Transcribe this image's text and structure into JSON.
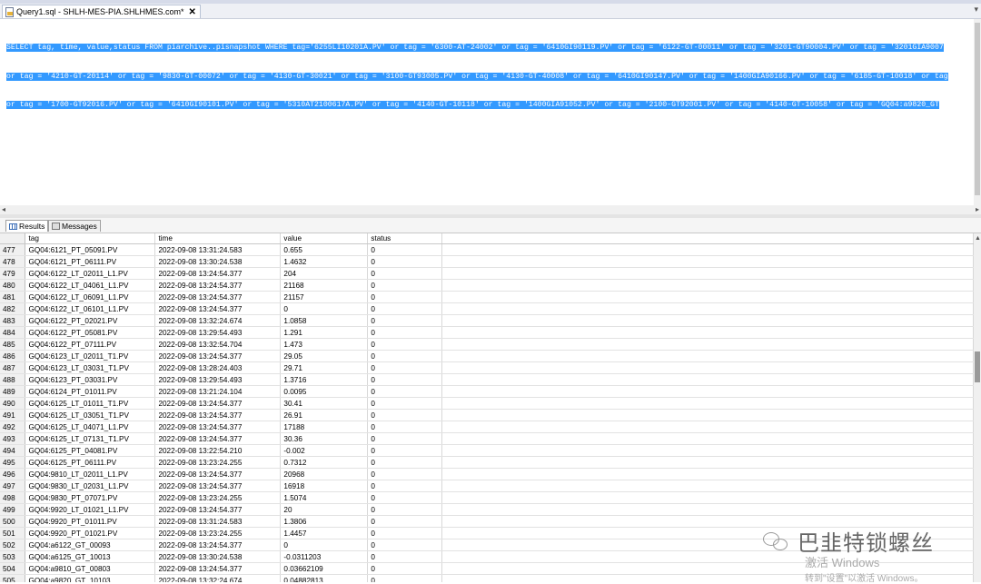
{
  "window": {
    "tab_title": "Query1.sql - SHLH-MES-PIA.SHLHMES.com*",
    "tab_close": "✕",
    "tab_pin": "▾"
  },
  "editor": {
    "lines": [
      "SELECT tag, time, value,status FROM piarchive..pisnapshot WHERE tag='6255LI10201A.PV' or tag = '6300-AT-24002' or tag = '6410GI90119.PV' or tag = '6122-GT-00011' or tag = '3201-GT90004.PV' or tag = '3201GIA9007",
      "or tag = '4210-GT-20114' or tag = '9830-GT-00072' or tag = '4130-GT-30021' or tag = '3100-GT93005.PV' or tag = '4130-GT-40008' or tag = '6410GI90147.PV' or tag = '1400GIA90166.PV' or tag = '6185-GT-10018' or tag",
      "or tag = '1700-GT92016.PV' or tag = '6410GI90101.PV' or tag = '5310AT2100617A.PV' or tag = '4140-GT-10118' or tag = '1400GIA91052.PV' or tag = '2100-GT92001.PV' or tag = '4140-GT-10058' or tag = 'GQ04:a9820_GT"
    ]
  },
  "results_tabs": [
    {
      "label": "Results",
      "icon": "grid-icon",
      "active": true
    },
    {
      "label": "Messages",
      "icon": "message-icon",
      "active": false
    }
  ],
  "grid": {
    "columns": [
      "tag",
      "time",
      "value",
      "status"
    ],
    "rows": [
      [
        "477",
        "GQ04:6121_PT_05091.PV",
        "2022-09-08 13:31:24.583",
        "0.655",
        "0"
      ],
      [
        "478",
        "GQ04:6121_PT_06111.PV",
        "2022-09-08 13:30:24.538",
        "1.4632",
        "0"
      ],
      [
        "479",
        "GQ04:6122_LT_02011_L1.PV",
        "2022-09-08 13:24:54.377",
        "204",
        "0"
      ],
      [
        "480",
        "GQ04:6122_LT_04061_L1.PV",
        "2022-09-08 13:24:54.377",
        "21168",
        "0"
      ],
      [
        "481",
        "GQ04:6122_LT_06091_L1.PV",
        "2022-09-08 13:24:54.377",
        "21157",
        "0"
      ],
      [
        "482",
        "GQ04:6122_LT_06101_L1.PV",
        "2022-09-08 13:24:54.377",
        "0",
        "0"
      ],
      [
        "483",
        "GQ04:6122_PT_02021.PV",
        "2022-09-08 13:32:24.674",
        "1.0858",
        "0"
      ],
      [
        "484",
        "GQ04:6122_PT_05081.PV",
        "2022-09-08 13:29:54.493",
        "1.291",
        "0"
      ],
      [
        "485",
        "GQ04:6122_PT_07111.PV",
        "2022-09-08 13:32:54.704",
        "1.473",
        "0"
      ],
      [
        "486",
        "GQ04:6123_LT_02011_T1.PV",
        "2022-09-08 13:24:54.377",
        "29.05",
        "0"
      ],
      [
        "487",
        "GQ04:6123_LT_03031_T1.PV",
        "2022-09-08 13:28:24.403",
        "29.71",
        "0"
      ],
      [
        "488",
        "GQ04:6123_PT_03031.PV",
        "2022-09-08 13:29:54.493",
        "1.3716",
        "0"
      ],
      [
        "489",
        "GQ04:6124_PT_01011.PV",
        "2022-09-08 13:21:24.104",
        "0.0095",
        "0"
      ],
      [
        "490",
        "GQ04:6125_LT_01011_T1.PV",
        "2022-09-08 13:24:54.377",
        "30.41",
        "0"
      ],
      [
        "491",
        "GQ04:6125_LT_03051_T1.PV",
        "2022-09-08 13:24:54.377",
        "26.91",
        "0"
      ],
      [
        "492",
        "GQ04:6125_LT_04071_L1.PV",
        "2022-09-08 13:24:54.377",
        "17188",
        "0"
      ],
      [
        "493",
        "GQ04:6125_LT_07131_T1.PV",
        "2022-09-08 13:24:54.377",
        "30.36",
        "0"
      ],
      [
        "494",
        "GQ04:6125_PT_04081.PV",
        "2022-09-08 13:22:54.210",
        "-0.002",
        "0"
      ],
      [
        "495",
        "GQ04:6125_PT_06111.PV",
        "2022-09-08 13:23:24.255",
        "0.7312",
        "0"
      ],
      [
        "496",
        "GQ04:9810_LT_02011_L1.PV",
        "2022-09-08 13:24:54.377",
        "20968",
        "0"
      ],
      [
        "497",
        "GQ04:9830_LT_02031_L1.PV",
        "2022-09-08 13:24:54.377",
        "16918",
        "0"
      ],
      [
        "498",
        "GQ04:9830_PT_07071.PV",
        "2022-09-08 13:23:24.255",
        "1.5074",
        "0"
      ],
      [
        "499",
        "GQ04:9920_LT_01021_L1.PV",
        "2022-09-08 13:24:54.377",
        "20",
        "0"
      ],
      [
        "500",
        "GQ04:9920_PT_01011.PV",
        "2022-09-08 13:31:24.583",
        "1.3806",
        "0"
      ],
      [
        "501",
        "GQ04:9920_PT_01021.PV",
        "2022-09-08 13:23:24.255",
        "1.4457",
        "0"
      ],
      [
        "502",
        "GQ04:a6122_GT_00093",
        "2022-09-08 13:24:54.377",
        "0",
        "0"
      ],
      [
        "503",
        "GQ04:a6125_GT_10013",
        "2022-09-08 13:30:24.538",
        "-0.0311203",
        "0"
      ],
      [
        "504",
        "GQ04:a9810_GT_00803",
        "2022-09-08 13:24:54.377",
        "0.03662109",
        "0"
      ],
      [
        "505",
        "GQ04:a9820_GT_10103",
        "2022-09-08 13:32:24.674",
        "0.04882813",
        "0"
      ],
      [
        "506",
        "GQ04:a9820_GT_10503",
        "2022-09-08 13:26:54.512",
        "0.02441406",
        "0"
      ],
      [
        "507",
        "GQ04:a9830_GT_10013",
        "2022-09-08 13:28:54.417",
        "5.69458",
        "0"
      ]
    ]
  },
  "watermark": {
    "brand": "巴韭特锁螺丝",
    "windows_line1": "激活 Windows",
    "windows_line2": "转到\"设置\"以激活 Windows。"
  }
}
